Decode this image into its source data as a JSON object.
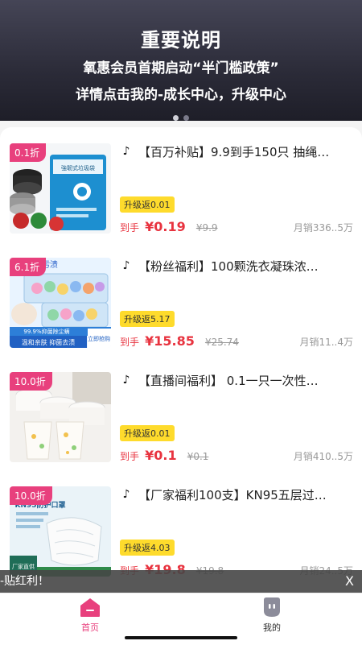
{
  "banner": {
    "title": "重要说明",
    "line1": "氧惠会员首期启动“半门槛政策”",
    "line2": "详情点击我的-成长中心，升级中心"
  },
  "products": [
    {
      "discount": "0.1折",
      "title": "【百万补贴】9.9到手150只 抽绳…",
      "rebate": "升级返0.01",
      "price_label": "到手",
      "price": "¥0.19",
      "original_price": "¥9.9",
      "sales": "月销336..5万",
      "image_text": "強韌式垃圾袋"
    },
    {
      "discount": "6.1折",
      "title": "【粉丝福利】100颗洗衣凝珠浓…",
      "rebate": "升级返5.17",
      "price_label": "到手",
      "price": "¥15.85",
      "original_price": "¥25.74",
      "sales": "月销11..4万",
      "image_text_1": "污渍",
      "image_text_2": "99.9%抑菌除尘螨",
      "image_text_3": "温和亲肤 抑菌去渍",
      "image_text_4": "立即抢购"
    },
    {
      "discount": "10.0折",
      "title": "【直播间福利】 0.1一只一次性…",
      "rebate": "升级返0.01",
      "price_label": "到手",
      "price": "¥0.1",
      "original_price": "¥0.1",
      "sales": "月销410..5万"
    },
    {
      "discount": "10.0折",
      "title": "【厂家福利100支】KN95五层过…",
      "rebate": "升级返4.03",
      "price_label": "到手",
      "price": "¥19.8",
      "original_price": "¥19.8",
      "sales": "月销24..5万",
      "image_text_1": "KN95防护口罩",
      "image_text_2": "厂家直供"
    }
  ],
  "toast": {
    "text": "-贴红利！",
    "close": "X"
  },
  "tabbar": {
    "home": "首页",
    "mine": "我的"
  },
  "colors": {
    "accent": "#e8407d",
    "price": "#e8333f",
    "rebate_bg": "#fedb2c"
  }
}
